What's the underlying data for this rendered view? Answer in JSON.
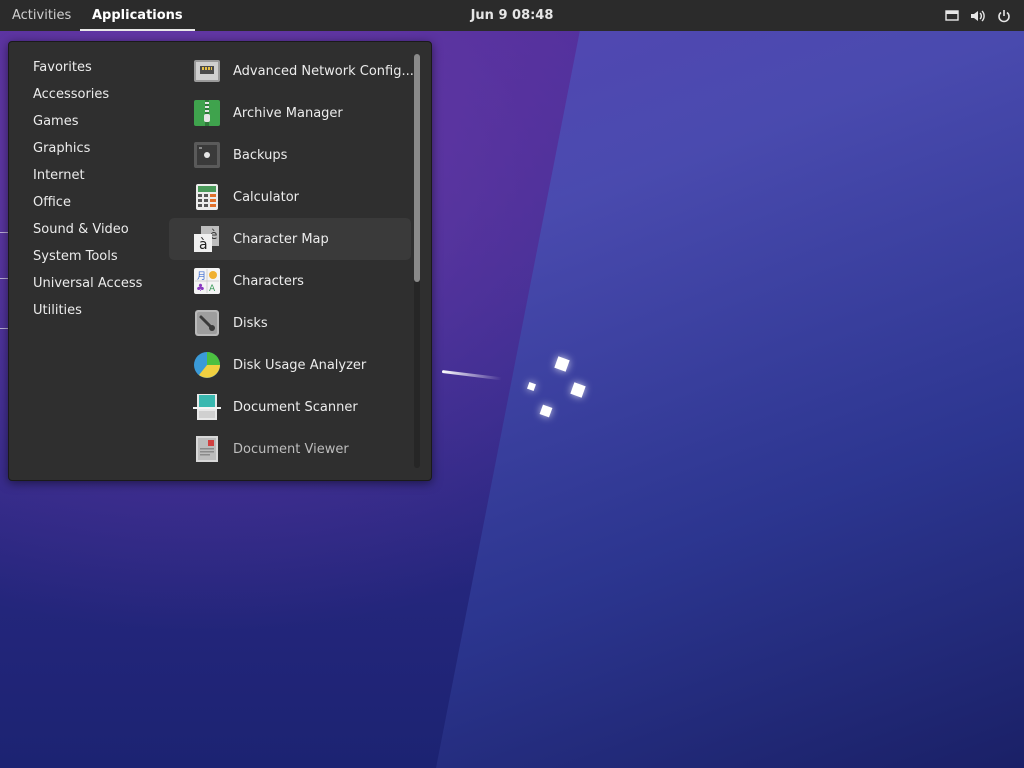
{
  "topbar": {
    "activities": "Activities",
    "applications": "Applications",
    "clock": "Jun 9  08:48",
    "tray_icons": [
      "display-icon",
      "volume-icon",
      "power-icon"
    ]
  },
  "menu": {
    "categories": [
      "Favorites",
      "Accessories",
      "Games",
      "Graphics",
      "Internet",
      "Office",
      "Sound & Video",
      "System Tools",
      "Universal Access",
      "Utilities"
    ],
    "apps": [
      {
        "label": "Advanced Network Config...",
        "icon": "network-config-icon"
      },
      {
        "label": "Archive Manager",
        "icon": "archive-manager-icon"
      },
      {
        "label": "Backups",
        "icon": "backups-icon"
      },
      {
        "label": "Calculator",
        "icon": "calculator-icon"
      },
      {
        "label": "Character Map",
        "icon": "character-map-icon"
      },
      {
        "label": "Characters",
        "icon": "characters-icon"
      },
      {
        "label": "Disks",
        "icon": "disks-icon"
      },
      {
        "label": "Disk Usage Analyzer",
        "icon": "disk-usage-analyzer-icon"
      },
      {
        "label": "Document Scanner",
        "icon": "document-scanner-icon"
      },
      {
        "label": "Document Viewer",
        "icon": "document-viewer-icon"
      }
    ],
    "hovered_app": "Character Map"
  },
  "colors": {
    "topbar_bg": "#2b2b2b",
    "menu_bg": "#2f2f2f",
    "wallpaper": "#2a2387"
  }
}
